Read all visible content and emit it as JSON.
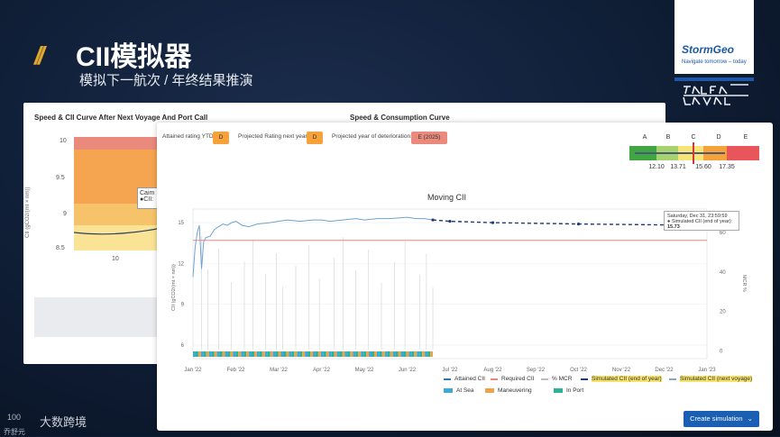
{
  "slide": {
    "title": "CII模拟器",
    "subtitle": "模拟下一航次 / 年终结果推演",
    "logo_text": "StormGeo",
    "logo_tagline": "Navigate tomorrow – today",
    "watermark_text": "大数跨境",
    "watermark_small": "100",
    "watermark_name": "乔舒元"
  },
  "back_panel": {
    "title_left": "Speed & CII Curve After Next Voyage And Port Call",
    "title_right": "Speed & Consumption Curve",
    "y_label": "CII (gCO2/(mt × nm))",
    "y_ticks": [
      "10",
      "9.5",
      "9",
      "8.5"
    ],
    "x_tick": "10",
    "tooltip_line1": "Caim",
    "tooltip_line2": "●CII:"
  },
  "front_panel": {
    "attained_label": "Attained rating YTD:",
    "attained_value": "D",
    "projected_label": "Projected Rating next year:",
    "projected_value": "D",
    "deterioration_label": "Projected year of deterioration:",
    "deterioration_value": "E (2025)",
    "scale_letters": [
      "A",
      "B",
      "C",
      "D",
      "E"
    ],
    "scale_values": [
      "12.10",
      "13.71",
      "15.60",
      "17.35"
    ],
    "scale_colors": [
      "#3fa642",
      "#a7d36e",
      "#f7e478",
      "#f6a13a",
      "#e8555a"
    ],
    "chart_title": "Moving CII",
    "tooltip_date": "Saturday, Dec 31, 23:59:59",
    "tooltip_label": "● Simulated CII (end of year):",
    "tooltip_value": "15.73",
    "create_button": "Create simulation",
    "chevron": "⌄"
  },
  "chart_data": {
    "type": "line",
    "title": "Moving CII",
    "xlabel": "",
    "ylabel": "CII (gCO2/(mt × nm))",
    "y2label": "MCR %",
    "x_ticks": [
      "Jan '22",
      "Feb '22",
      "Mar '22",
      "Apr '22",
      "May '22",
      "Jun '22",
      "Jul '22",
      "Aug '22",
      "Sep '22",
      "Oct '22",
      "Nov '22",
      "Dec '22",
      "Jan '23"
    ],
    "y_ticks": [
      "15",
      "12",
      "9",
      "6"
    ],
    "y2_ticks": [
      "60",
      "40",
      "20",
      "0"
    ],
    "ylim": [
      5,
      16
    ],
    "y2lim": [
      -4,
      72
    ],
    "series": [
      {
        "name": "Attained CII",
        "color": "#6fa3d2",
        "x": [
          0.0,
          0.05,
          0.1,
          0.15,
          0.2,
          0.25,
          0.3,
          0.4,
          0.5,
          0.6,
          0.7,
          0.8,
          0.9,
          1.0,
          1.15,
          1.3,
          1.5,
          1.8,
          2.0,
          2.2,
          2.5,
          2.8,
          3.0,
          3.2,
          3.5,
          3.8,
          4.0,
          4.3,
          4.6,
          5.0,
          5.2,
          5.4,
          5.6
        ],
        "y": [
          11.0,
          13.2,
          14.3,
          14.8,
          11.6,
          13.6,
          13.9,
          14.0,
          14.5,
          14.7,
          14.9,
          14.8,
          15.0,
          15.1,
          14.8,
          14.7,
          14.9,
          15.0,
          15.1,
          15.2,
          15.1,
          15.2,
          15.2,
          15.1,
          15.2,
          15.3,
          15.2,
          15.3,
          15.3,
          15.4,
          15.3,
          15.3,
          15.2
        ]
      },
      {
        "name": "Required CII",
        "color": "#e28a7a",
        "x": [
          0,
          12
        ],
        "y": [
          13.7,
          13.7
        ]
      },
      {
        "name": "Simulated CII (end of year)",
        "color": "#1f3b70",
        "x": [
          5.6,
          6.0,
          7.0,
          9.0,
          12.0
        ],
        "y": [
          15.2,
          15.1,
          15.0,
          14.9,
          14.8
        ]
      }
    ],
    "legend": [
      "Attained CII",
      "Required CII",
      "% MCR",
      "Simulated CII (end of year)",
      "Simulated CII (next voyage)"
    ],
    "legend2": [
      "At Sea",
      "Maneuvering",
      "In Port"
    ],
    "legend_colors": [
      "#2f74c0",
      "#e28a7a",
      "#bdbdbd",
      "#1f3b70",
      "#8aa6c8"
    ],
    "legend2_colors": [
      "#3fa9d6",
      "#f0a24a",
      "#2bb39a"
    ],
    "strip_colors": [
      "#3fa9d6",
      "#f0a24a",
      "#2bb39a"
    ],
    "grid": true,
    "legend_position": "bottom"
  }
}
